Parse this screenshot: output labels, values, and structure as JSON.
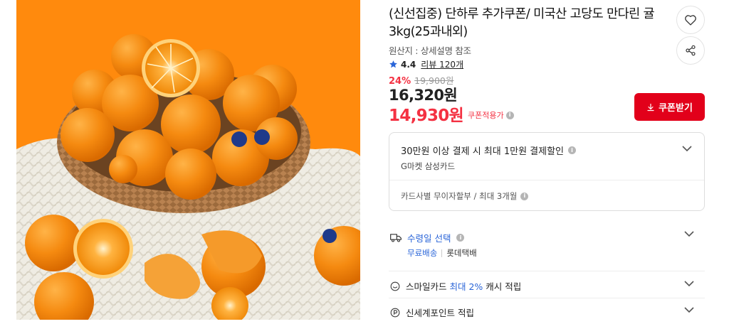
{
  "product": {
    "title": "(신선집중) 단하루 추가쿠폰/ 미국산 고당도 만다린 귤 3kg(25과내외)",
    "origin": "원산지 : 상세설명 참조",
    "rating": "4.4",
    "review_label": "리뷰 120개",
    "discount_pct": "24%",
    "original_price": "19,900원",
    "sale_price": "16,320원",
    "coupon_price": "14,930원",
    "coupon_note": "쿠폰적용가"
  },
  "actions": {
    "wishlist_icon": "heart-icon",
    "share_icon": "share-icon",
    "coupon_button": "쿠폰받기"
  },
  "benefits": {
    "card_headline": "30만원 이상 결제 시 최대 1만원 결제할인",
    "card_name": "G마켓 삼성카드",
    "installment": "카드사별 무이자할부 / 최대 3개월"
  },
  "delivery": {
    "label": "수령일 선택",
    "free_shipping": "무료배송",
    "courier": "롯데택배"
  },
  "smile": {
    "prefix": "스마일카드",
    "highlight": "최대 2%",
    "suffix": "캐시 적립"
  },
  "points": {
    "label": "신세계포인트 적립"
  },
  "colors": {
    "accent_red": "#e2001a",
    "price_red": "#f43142",
    "link_blue": "#2a65d8",
    "image_bg_orange": "#ff8a0d"
  }
}
